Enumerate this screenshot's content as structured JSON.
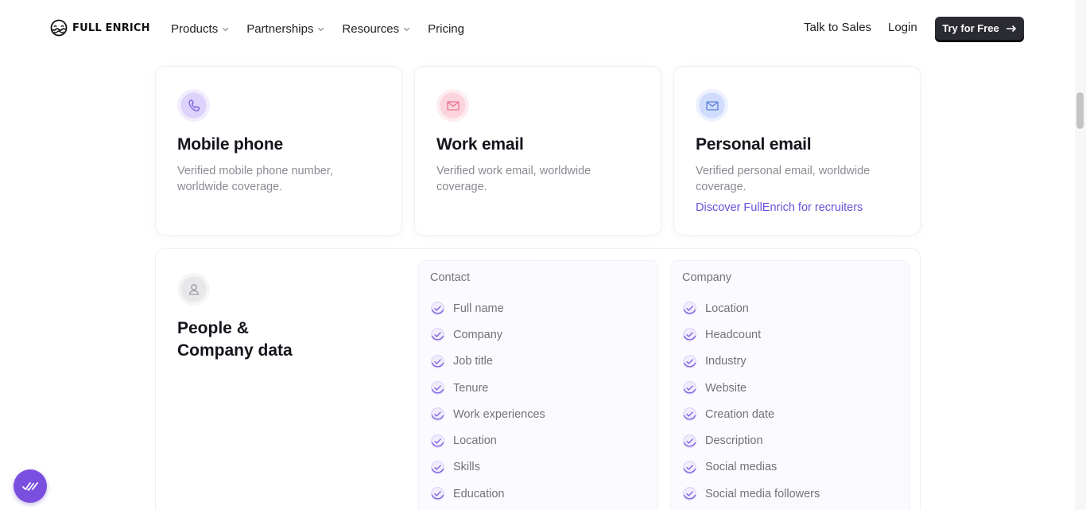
{
  "nav": {
    "brand": "FULL ENRICH",
    "menu": [
      {
        "label": "Products",
        "has_dropdown": true
      },
      {
        "label": "Partnerships",
        "has_dropdown": true
      },
      {
        "label": "Resources",
        "has_dropdown": true
      },
      {
        "label": "Pricing",
        "has_dropdown": false
      }
    ],
    "talk_to_sales": "Talk to Sales",
    "login": "Login",
    "cta": "Try for Free"
  },
  "cards": [
    {
      "icon": "phone-icon",
      "title": "Mobile phone",
      "description": "Verified mobile phone number, worldwide coverage."
    },
    {
      "icon": "mail-icon",
      "title": "Work email",
      "description": "Verified work email, worldwide coverage."
    },
    {
      "icon": "mail-icon",
      "title": "Personal email",
      "description": "Verified personal email, worldwide coverage.",
      "link": "Discover FullEnrich for recruiters"
    }
  ],
  "people_company": {
    "icon": "user-icon",
    "title_line1": "People &",
    "title_line2": "Company data",
    "contact": {
      "heading": "Contact",
      "items": [
        "Full name",
        "Company",
        "Job title",
        "Tenure",
        "Work experiences",
        "Location",
        "Skills",
        "Education"
      ]
    },
    "company": {
      "heading": "Company",
      "items": [
        "Location",
        "Headcount",
        "Industry",
        "Website",
        "Creation date",
        "Description",
        "Social medias",
        "Social media followers"
      ]
    }
  },
  "colors": {
    "accent": "#7a4fe0",
    "link": "#6b4fd8",
    "cta_bg": "#2b2b33"
  }
}
